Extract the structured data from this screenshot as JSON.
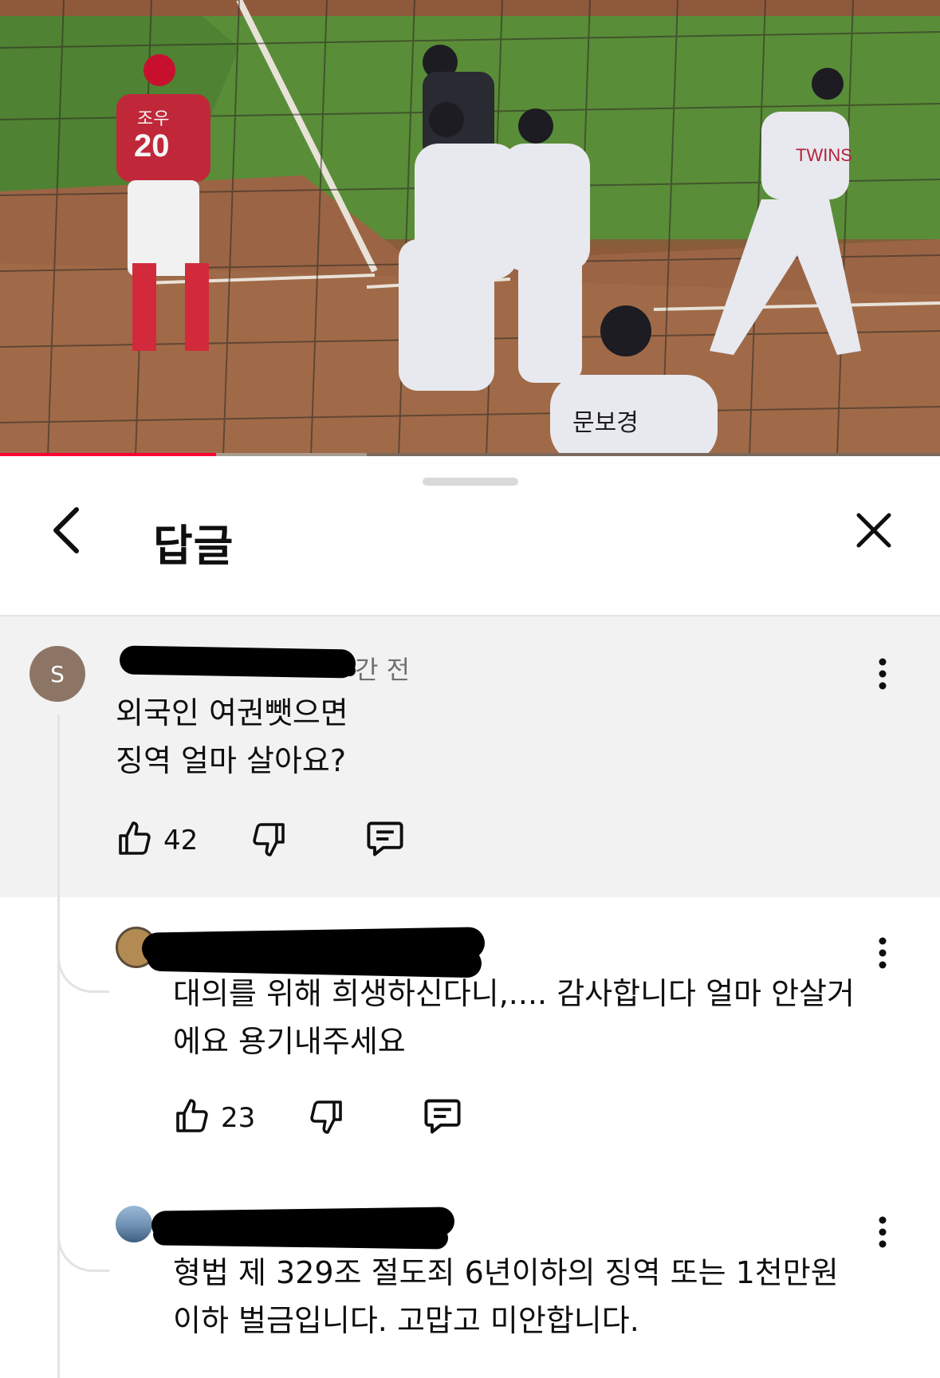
{
  "video": {
    "progress_fraction": 0.23,
    "buffered_fraction": 0.39,
    "jersey_texts": {
      "catcher_number": "20",
      "catcher_name": "조우",
      "player_name": "문보경",
      "team_text": "TWINS"
    }
  },
  "sheet": {
    "title": "답글"
  },
  "parent_comment": {
    "avatar_letter": "S",
    "time_visible": "간 전",
    "lines": [
      "외국인 여권뺏으면",
      "징역 얼마 살아요?"
    ],
    "likes": "42"
  },
  "replies": [
    {
      "lines": [
        "대의를 위해 희생하신다니,.... 감사합니다 얼마 안살거",
        "에요 용기내주세요"
      ],
      "likes": "23"
    },
    {
      "lines": [
        "형법 제 329조 절도죄 6년이하의 징역 또는 1천만원",
        "이하 벌금입니다. 고맙고 미안합니다."
      ]
    }
  ],
  "icons": {
    "back": "chevron-left-icon",
    "close": "close-icon",
    "more": "more-vertical-icon",
    "like": "thumbs-up-icon",
    "dislike": "thumbs-down-icon",
    "reply": "comment-icon"
  },
  "colors": {
    "progress": "#ff0033",
    "parent_background": "#f2f2f2",
    "avatar": "#8d7566"
  }
}
